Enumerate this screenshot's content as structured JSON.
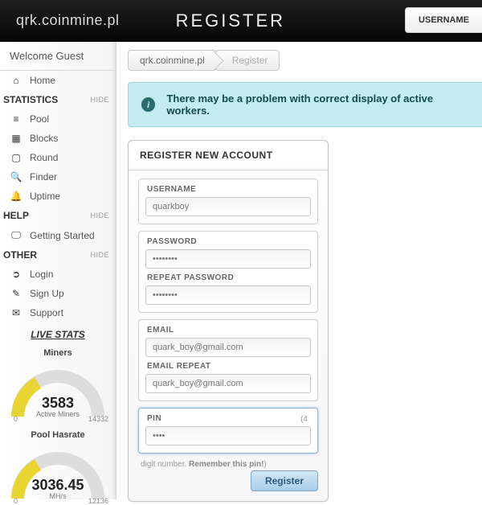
{
  "top": {
    "brand": "qrk.coinmine.pl",
    "title": "REGISTER",
    "login_btn": "USERNAME"
  },
  "sidebar": {
    "welcome": "Welcome Guest",
    "home": "Home",
    "sect_stats": "STATISTICS",
    "hide": "HIDE",
    "stats": {
      "pool": "Pool",
      "blocks": "Blocks",
      "round": "Round",
      "finder": "Finder",
      "uptime": "Uptime"
    },
    "sect_help": "HELP",
    "help": {
      "gs": "Getting Started"
    },
    "sect_other": "OTHER",
    "other": {
      "login": "Login",
      "signup": "Sign Up",
      "support": "Support"
    },
    "live": "LIVE STATS",
    "g1": {
      "title": "Miners",
      "value": "3583",
      "sub": "Active Miners",
      "lo": "0",
      "hi": "14332"
    },
    "g2": {
      "title": "Pool Hasrate",
      "value": "3036.45",
      "sub": "MH/s",
      "lo": "0",
      "hi": "12136"
    }
  },
  "crumbs": {
    "a": "qrk.coinmine.pl",
    "b": "Register"
  },
  "alert": "There may be a problem with correct display of active workers.",
  "panel": {
    "title": "REGISTER NEW ACCOUNT"
  },
  "form": {
    "username_l": "USERNAME",
    "username": "quarkboy",
    "password_l": "PASSWORD",
    "password": "••••••••",
    "rpassword_l": "REPEAT PASSWORD",
    "rpassword": "••••••••",
    "email_l": "EMAIL",
    "email": "quark_boy@gmail.com",
    "remail_l": "EMAIL REPEAT",
    "remail": "quark_boy@gmail.com",
    "pin_l": "PIN",
    "pin": "••••",
    "pin_hint0": "(4",
    "pin_hint1a": "digit number. ",
    "pin_hint1b": "Remember this pin!",
    "pin_hint1c": ")",
    "submit": "Register"
  }
}
